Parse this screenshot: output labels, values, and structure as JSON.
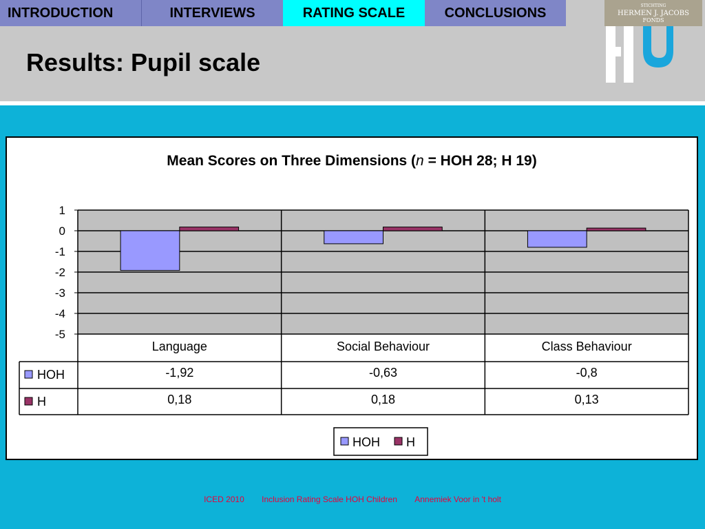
{
  "nav": {
    "tabs": [
      {
        "label": "INTRODUCTION",
        "active": false
      },
      {
        "label": "INTERVIEWS",
        "active": false
      },
      {
        "label": "RATING SCALE",
        "active": true
      },
      {
        "label": "CONCLUSIONS",
        "active": false
      }
    ]
  },
  "logo": {
    "line1": "STICHTING",
    "line2": "HERMEN J. JACOBS",
    "line3": "FONDS"
  },
  "page": {
    "title": "Results: Pupil scale"
  },
  "colors": {
    "background": "#0db2d8",
    "header": "#c8c8c8",
    "tab": "#7f86c7",
    "tab_active": "#00ffff",
    "plot_area": "#c0c0c0",
    "hoh": "#9999ff",
    "h": "#993366",
    "footer_text": "#e8003a"
  },
  "chart_data": {
    "type": "bar",
    "title_prefix": "Mean Scores on Three Dimensions (",
    "title_italic": "n",
    "title_suffix": " = HOH 28; H 19)",
    "categories": [
      "Language",
      "Social Behaviour",
      "Class Behaviour"
    ],
    "series": [
      {
        "name": "HOH",
        "values": [
          -1.92,
          -0.63,
          -0.8
        ],
        "labels": [
          "-1,92",
          "-0,63",
          "-0,8"
        ],
        "color": "#9999ff"
      },
      {
        "name": "H",
        "values": [
          0.18,
          0.18,
          0.13
        ],
        "labels": [
          "0,18",
          "0,18",
          "0,13"
        ],
        "color": "#993366"
      }
    ],
    "ylim": [
      -5,
      1
    ],
    "yticks": [
      "1",
      "0",
      "-1",
      "-2",
      "-3",
      "-4",
      "-5"
    ],
    "grid": true,
    "legend": [
      "HOH",
      "H"
    ],
    "legend_position": "bottom",
    "data_table": true
  },
  "footer": {
    "items": [
      "ICED 2010",
      "Inclusion Rating Scale HOH Children",
      "Annemiek Voor in 't holt"
    ]
  }
}
